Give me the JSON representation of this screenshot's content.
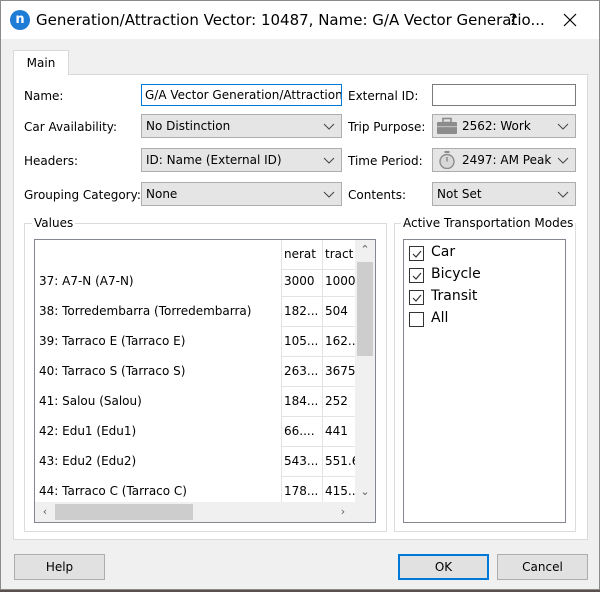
{
  "window": {
    "title": "Generation/Attraction Vector: 10487, Name: G/A Vector Generatio...",
    "app_icon_glyph": "n",
    "help_glyph": "?",
    "close_icon": "close-icon"
  },
  "tabs": [
    {
      "label": "Main",
      "active": true
    }
  ],
  "form": {
    "name_label": "Name:",
    "name_value": "G/A Vector Generation/Attraction S",
    "external_id_label": "External ID:",
    "external_id_value": "",
    "car_availability_label": "Car Availability:",
    "car_availability_value": "No Distinction",
    "trip_purpose_label": "Trip Purpose:",
    "trip_purpose_value": "2562: Work",
    "trip_purpose_icon": "briefcase-icon",
    "headers_label": "Headers:",
    "headers_value": "ID: Name (External ID)",
    "time_period_label": "Time Period:",
    "time_period_value": "2497: AM Peak",
    "time_period_icon": "stopwatch-icon",
    "grouping_category_label": "Grouping Category:",
    "grouping_category_value": "None",
    "contents_label": "Contents:",
    "contents_value": "Not Set"
  },
  "values": {
    "title": "Values",
    "columns": [
      "",
      "nerat",
      "tract"
    ],
    "rows": [
      {
        "name": "37: A7-N (A7-N)",
        "gen": "3000",
        "attr": "1000"
      },
      {
        "name": "38: Torredembarra (Torredembarra)",
        "gen": "182...",
        "attr": "504"
      },
      {
        "name": "39: Tarraco E (Tarraco E)",
        "gen": "105...",
        "attr": "162.."
      },
      {
        "name": "40: Tarraco S (Tarraco S)",
        "gen": "263...",
        "attr": "3675"
      },
      {
        "name": "41: Salou (Salou)",
        "gen": "184...",
        "attr": "252"
      },
      {
        "name": "42: Edu1 (Edu1)",
        "gen": "66....",
        "attr": "441"
      },
      {
        "name": "43: Edu2 (Edu2)",
        "gen": "543...",
        "attr": "551.6"
      },
      {
        "name": "44: Tarraco C (Tarraco C)",
        "gen": "178...",
        "attr": "415.."
      }
    ]
  },
  "modes": {
    "title": "Active Transportation Modes",
    "items": [
      {
        "label": "Car",
        "checked": true
      },
      {
        "label": "Bicycle",
        "checked": true
      },
      {
        "label": "Transit",
        "checked": true
      },
      {
        "label": "All",
        "checked": false
      }
    ]
  },
  "buttons": {
    "help": "Help",
    "ok": "OK",
    "cancel": "Cancel"
  }
}
